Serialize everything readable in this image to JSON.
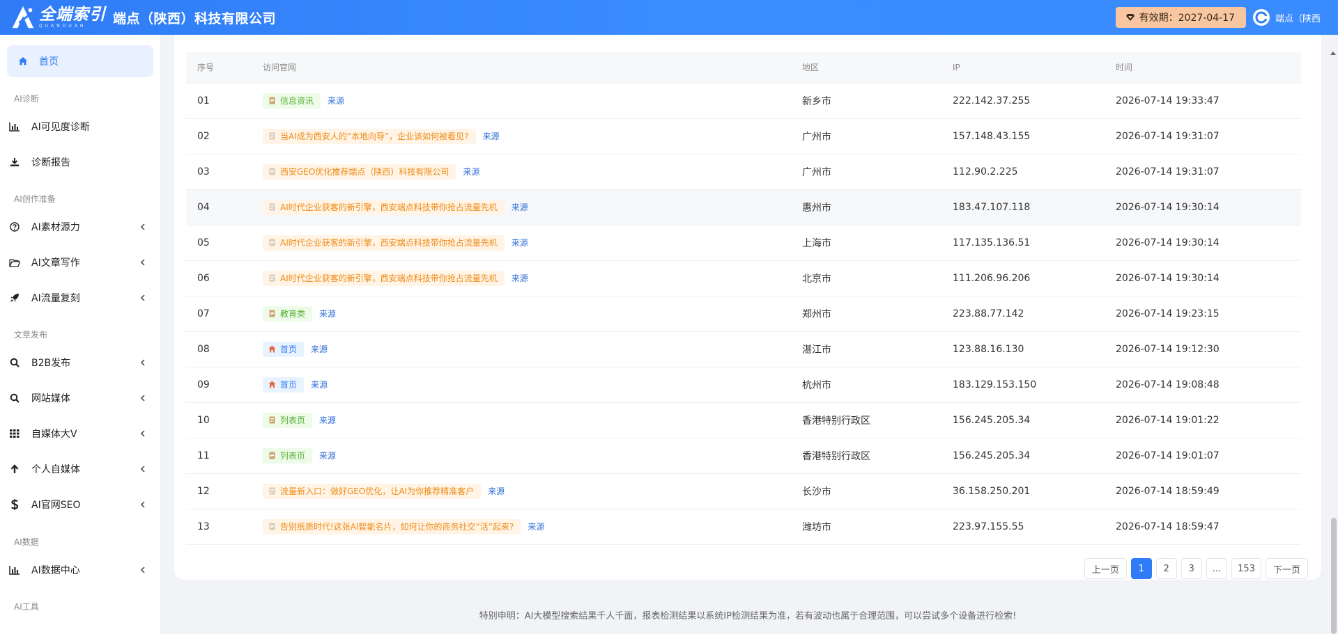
{
  "header": {
    "logo_cn": "全端索引",
    "logo_en": "QUANDUAN",
    "company": "端点（陕西）科技有限公司",
    "expiry_label": "有效期：2027-04-17",
    "user_name": "端点（陕西"
  },
  "sidebar": {
    "home": "首页",
    "sections": [
      {
        "title": "AI诊断",
        "items": [
          {
            "label": "AI可见度诊断",
            "icon": "bar-chart-icon",
            "chevron": false
          },
          {
            "label": "诊断报告",
            "icon": "download-icon",
            "chevron": false
          }
        ]
      },
      {
        "title": "AI创作准备",
        "items": [
          {
            "label": "AI素材源力",
            "icon": "question-circle-icon",
            "chevron": true
          },
          {
            "label": "AI文章写作",
            "icon": "folder-open-icon",
            "chevron": true
          },
          {
            "label": "AI流量复刻",
            "icon": "rocket-icon",
            "chevron": true
          }
        ]
      },
      {
        "title": "文章发布",
        "items": [
          {
            "label": "B2B发布",
            "icon": "search-icon",
            "chevron": true
          },
          {
            "label": "网站媒体",
            "icon": "search-icon",
            "chevron": true
          },
          {
            "label": "自媒体大V",
            "icon": "grid-icon",
            "chevron": true
          },
          {
            "label": "个人自媒体",
            "icon": "arrow-up-icon",
            "chevron": true
          },
          {
            "label": "AI官网SEO",
            "icon": "dollar-icon",
            "chevron": true
          }
        ]
      },
      {
        "title": "AI数据",
        "items": [
          {
            "label": "AI数据中心",
            "icon": "bar-chart-icon",
            "chevron": true
          }
        ]
      },
      {
        "title": "AI工具",
        "items": []
      }
    ]
  },
  "table": {
    "columns": [
      "序号",
      "访问官网",
      "地区",
      "IP",
      "时间"
    ],
    "source_label": "来源",
    "rows": [
      {
        "seq": "01",
        "tag": "信息资讯",
        "tag_type": "green",
        "area": "新乡市",
        "ip": "222.142.37.255",
        "time": "2026-07-14 19:33:47"
      },
      {
        "seq": "02",
        "tag": "当AI成为西安人的“本地向导”，企业该如何被看见?",
        "tag_type": "orange",
        "area": "广州市",
        "ip": "157.148.43.155",
        "time": "2026-07-14 19:31:07"
      },
      {
        "seq": "03",
        "tag": "西安GEO优化推荐端点（陕西）科技有限公司",
        "tag_type": "orange",
        "area": "广州市",
        "ip": "112.90.2.225",
        "time": "2026-07-14 19:31:07"
      },
      {
        "seq": "04",
        "tag": "AI时代企业获客的新引擎，西安端点科技带你抢占流量先机",
        "tag_type": "orange",
        "area": "惠州市",
        "ip": "183.47.107.118",
        "time": "2026-07-14 19:30:14"
      },
      {
        "seq": "05",
        "tag": "AI时代企业获客的新引擎，西安端点科技带你抢占流量先机",
        "tag_type": "orange",
        "area": "上海市",
        "ip": "117.135.136.51",
        "time": "2026-07-14 19:30:14"
      },
      {
        "seq": "06",
        "tag": "AI时代企业获客的新引擎，西安端点科技带你抢占流量先机",
        "tag_type": "orange",
        "area": "北京市",
        "ip": "111.206.96.206",
        "time": "2026-07-14 19:30:14"
      },
      {
        "seq": "07",
        "tag": "教育类",
        "tag_type": "green",
        "area": "郑州市",
        "ip": "223.88.77.142",
        "time": "2026-07-14 19:23:15"
      },
      {
        "seq": "08",
        "tag": "首页",
        "tag_type": "blue",
        "area": "湛江市",
        "ip": "123.88.16.130",
        "time": "2026-07-14 19:12:30"
      },
      {
        "seq": "09",
        "tag": "首页",
        "tag_type": "blue",
        "area": "杭州市",
        "ip": "183.129.153.150",
        "time": "2026-07-14 19:08:48"
      },
      {
        "seq": "10",
        "tag": "列表页",
        "tag_type": "green",
        "area": "香港特别行政区",
        "ip": "156.245.205.34",
        "time": "2026-07-14 19:01:22"
      },
      {
        "seq": "11",
        "tag": "列表页",
        "tag_type": "green",
        "area": "香港特别行政区",
        "ip": "156.245.205.34",
        "time": "2026-07-14 19:01:07"
      },
      {
        "seq": "12",
        "tag": "流量新入口：做好GEO优化，让AI为你推荐精准客户",
        "tag_type": "orange",
        "area": "长沙市",
        "ip": "36.158.250.201",
        "time": "2026-07-14 18:59:49"
      },
      {
        "seq": "13",
        "tag": "告别纸质时代!这张AI智能名片，如何让你的商务社交“活”起来?",
        "tag_type": "orange",
        "area": "潍坊市",
        "ip": "223.97.155.55",
        "time": "2026-07-14 18:59:47"
      }
    ]
  },
  "pagination": {
    "prev": "上一页",
    "pages": [
      "1",
      "2",
      "3",
      "...",
      "153"
    ],
    "active": "1",
    "next": "下一页"
  },
  "disclaimer": "特别申明：AI大模型搜索结果千人千面，报表检测结果以系统IP检测结果为准，若有波动也属于合理范围，可以尝试多个设备进行检索!",
  "colors": {
    "accent": "#2f7cf6",
    "expiry_bg": "#f8c7a1",
    "tag_green": "#55b135",
    "tag_orange": "#ef8a14"
  }
}
